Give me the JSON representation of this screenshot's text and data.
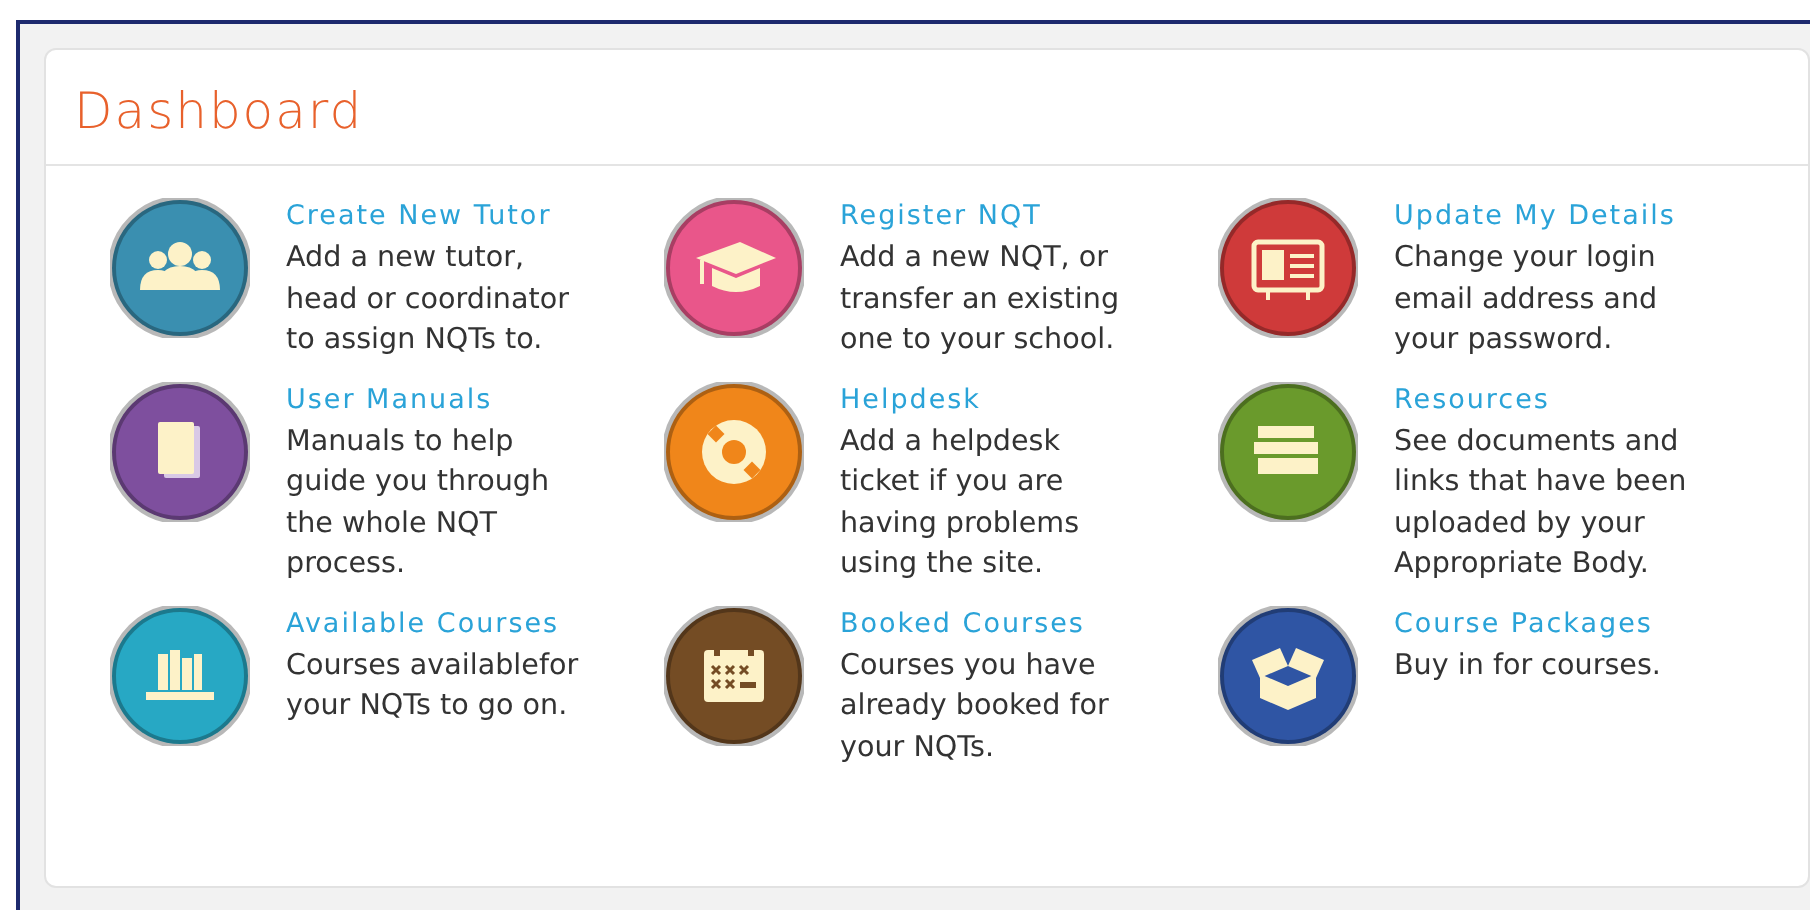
{
  "panel": {
    "title": "Dashboard"
  },
  "items": [
    {
      "title": "Create New Tutor",
      "description": "Add a new tutor, head or coordinator to assign NQTs to.",
      "kind": "people",
      "color": "#3a8fb0"
    },
    {
      "title": "Register NQT",
      "description": "Add a new NQT, or transfer an existing one to your school.",
      "kind": "cap",
      "color": "#e9568a"
    },
    {
      "title": "Update My Details",
      "description": "Change your login email address and your password.",
      "kind": "card",
      "color": "#cf3a3a"
    },
    {
      "title": "User Manuals",
      "description": "Manuals to help guide you through the whole NQT process.",
      "kind": "book",
      "color": "#7e4f9e"
    },
    {
      "title": "Helpdesk",
      "description": "Add a helpdesk ticket if you are having problems using the site.",
      "kind": "lifebuoy",
      "color": "#f0861a"
    },
    {
      "title": "Resources",
      "description": "See documents and links that have been uploaded by your Appropriate Body.",
      "kind": "stack",
      "color": "#6a9a2c"
    },
    {
      "title": "Available Courses",
      "description": "Courses availablefor your NQTs to go on.",
      "kind": "shelf",
      "color": "#27a8c4"
    },
    {
      "title": "Booked Courses",
      "description": "Courses you have already booked for your NQTs.",
      "kind": "calendar",
      "color": "#744c24"
    },
    {
      "title": "Course Packages",
      "description": "Buy in for courses.",
      "kind": "box",
      "color": "#2f55a4"
    }
  ]
}
